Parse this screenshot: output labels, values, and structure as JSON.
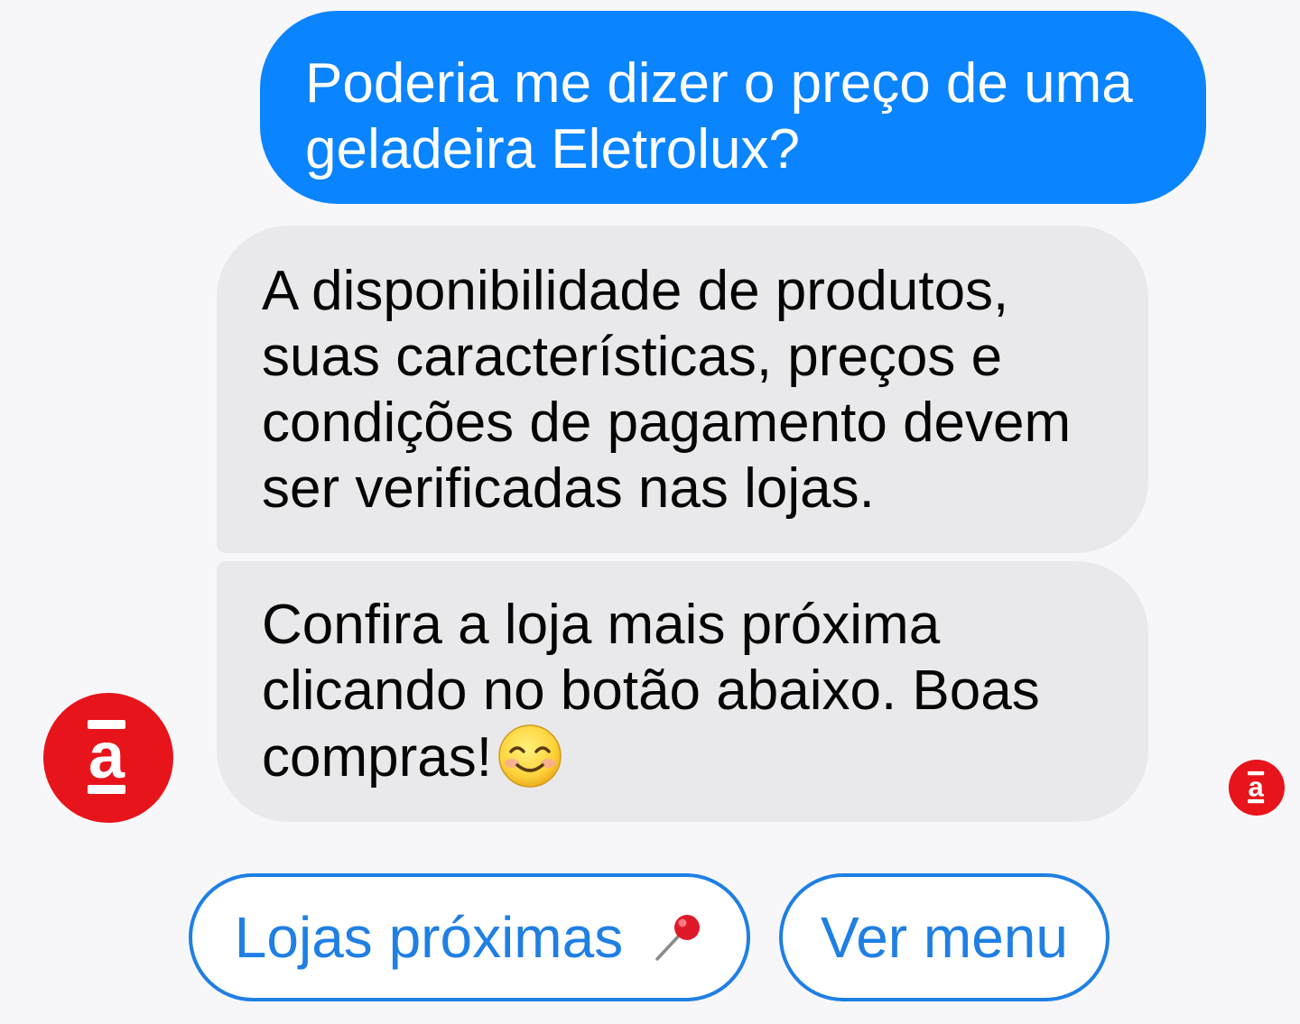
{
  "conversation": {
    "user_message": {
      "lines": [
        "Poderia me dizer o preço de uma",
        "geladeira Eletrolux?"
      ]
    },
    "bot_messages": [
      {
        "lines": [
          "A disponibilidade de produtos,",
          "suas características, preços e",
          "condições de pagamento devem",
          "ser verificadas nas lojas."
        ]
      },
      {
        "lines": [
          "Confira a loja mais próxima",
          "clicando no botão abaixo. Boas",
          "compras!"
        ],
        "trailing_emoji": "smiling-face-icon"
      }
    ],
    "bot_avatar": {
      "icon": "americanas-logo-icon",
      "color": "#e8141b"
    },
    "read_receipt": {
      "icon": "americanas-logo-icon",
      "color": "#e8141b"
    }
  },
  "quick_replies": [
    {
      "label": "Lojas próximas",
      "icon": "pushpin-icon"
    },
    {
      "label": "Ver menu"
    }
  ],
  "colors": {
    "user_bubble": "#0a84ff",
    "bot_bubble": "#e9e9eb",
    "accent": "#1f7fe3",
    "brand": "#e8141b"
  }
}
